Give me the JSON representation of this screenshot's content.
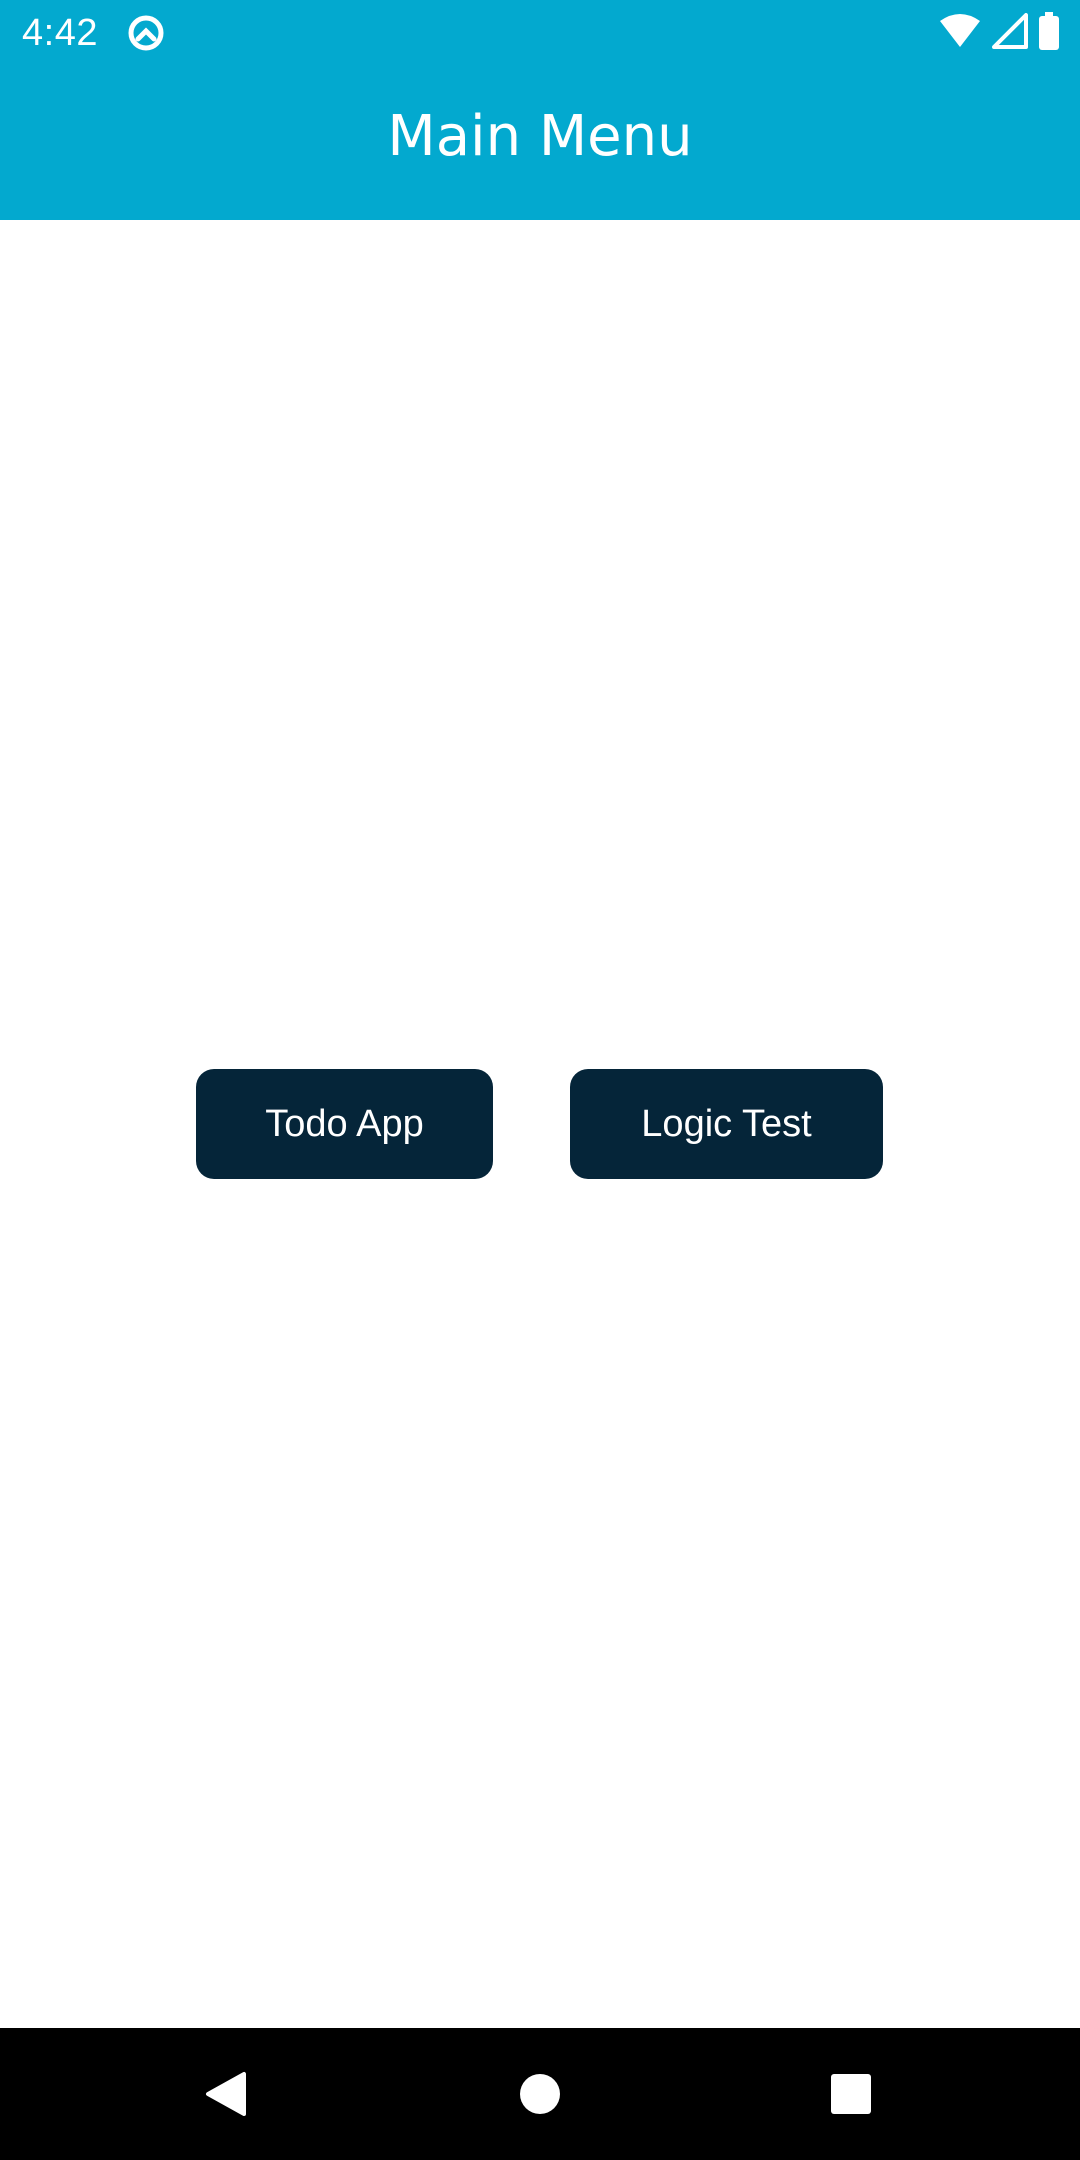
{
  "status_bar": {
    "time": "4:42",
    "app_icon": "sync-circle-icon",
    "icons": [
      "wifi-icon",
      "signal-icon",
      "battery-icon"
    ]
  },
  "app_bar": {
    "title": "Main Menu",
    "background_color": "#03A9CF"
  },
  "main": {
    "buttons": [
      {
        "label": "Todo App"
      },
      {
        "label": "Logic Test"
      }
    ],
    "button_color": "#052539"
  },
  "nav_bar": {
    "icons": [
      "back-icon",
      "home-icon",
      "recents-icon"
    ]
  }
}
